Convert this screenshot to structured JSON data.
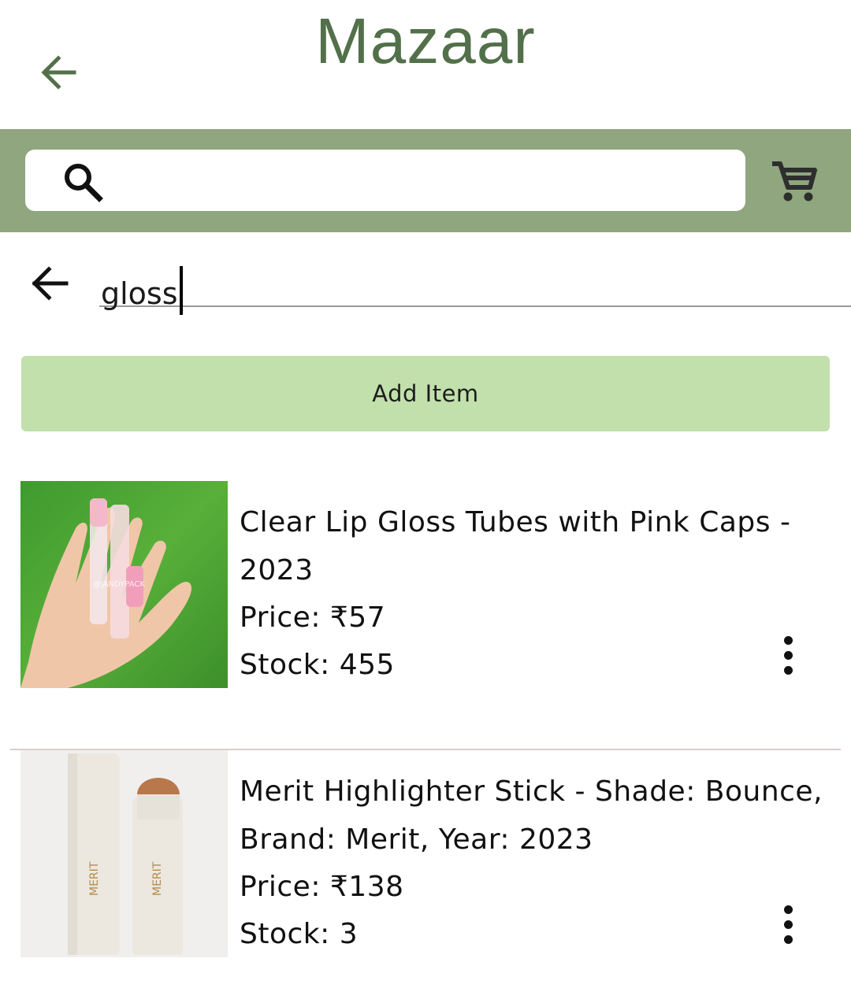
{
  "app": {
    "title": "Mazaar",
    "brand_color": "#52704a",
    "bar_color": "#8fa67e"
  },
  "header": {
    "back_icon": "arrow-left-icon"
  },
  "search": {
    "icon": "search-icon",
    "value": "",
    "cart_icon": "cart-icon"
  },
  "query": {
    "value": "gloss",
    "back_icon": "arrow-left-icon"
  },
  "actions": {
    "add_item_label": "Add Item",
    "add_item_color": "#c2e0ab"
  },
  "products": [
    {
      "name": "Clear Lip Gloss Tubes with Pink Caps - 2023",
      "price": "Price: ₹57",
      "stock": "Stock: 455",
      "image_watermark": "@JANDYPACK"
    },
    {
      "name": "Merit Highlighter Stick - Shade: Bounce, Brand: Merit, Year: 2023",
      "price": "Price: ₹138",
      "stock": "Stock: 3",
      "image_brand": "MERIT"
    }
  ]
}
